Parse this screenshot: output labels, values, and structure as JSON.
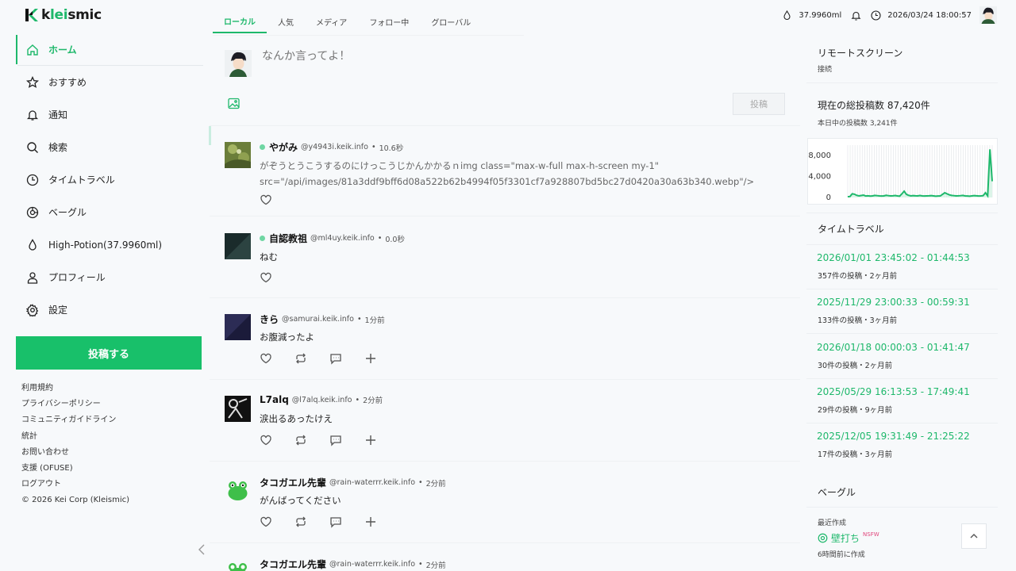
{
  "app": {
    "logo_k": "k",
    "logo_lei": "lei",
    "logo_smic": "smic"
  },
  "sidebar": {
    "items": [
      {
        "label": "ホーム",
        "icon": "home-icon"
      },
      {
        "label": "おすすめ",
        "icon": "star-icon"
      },
      {
        "label": "通知",
        "icon": "bell-icon"
      },
      {
        "label": "検索",
        "icon": "search-icon"
      },
      {
        "label": "タイムトラベル",
        "icon": "clock-icon"
      },
      {
        "label": "ベーグル",
        "icon": "bagel-icon"
      },
      {
        "label": "High-Potion(37.9960ml)",
        "icon": "drop-icon"
      },
      {
        "label": "プロフィール",
        "icon": "user-icon"
      },
      {
        "label": "設定",
        "icon": "gear-icon"
      }
    ],
    "post_button": "投稿する",
    "footer": [
      "利用規約",
      "プライバシーポリシー",
      "コミュニティガイドライン",
      "統計",
      "お問い合わせ",
      "支援 (OFUSE)",
      "ログアウト",
      "© 2026 Kei Corp (Kleismic)"
    ]
  },
  "tabs": [
    "ローカル",
    "人気",
    "メディア",
    "フォロー中",
    "グローバル"
  ],
  "compose": {
    "placeholder": "なんか言ってよ！",
    "submit": "投稿"
  },
  "posts": [
    {
      "name": "やがみ",
      "handle": "@y4943i.keik.info",
      "time": "10.6秒",
      "online": true,
      "body": "がぞうとうこうするのにけっこうじかんかかるｎimg class=\"max-w-full max-h-screen my-1\" src=\"/api/images/81a3ddf9bff6d08a522b62b4994f05f3301cf7a928807bd5bc27d0420a30a63b340.webp\"/>"
    },
    {
      "name": "自認教祖",
      "handle": "@ml4uy.keik.info",
      "time": "0.0秒",
      "online": true,
      "body": "ねむ"
    },
    {
      "name": "きら",
      "handle": "@samurai.keik.info",
      "time": "1分前",
      "online": false,
      "body": "お腹減ったよ"
    },
    {
      "name": "L7alq",
      "handle": "@l7alq.keik.info",
      "time": "2分前",
      "online": false,
      "body": "涙出るあったけえ"
    },
    {
      "name": "タコガエル先輩",
      "handle": "@rain-waterrr.keik.info",
      "time": "2分前",
      "online": false,
      "body": "がんばってください"
    },
    {
      "name": "タコガエル先輩",
      "handle": "@rain-waterrr.keik.info",
      "time": "2分前",
      "online": false,
      "body": ""
    }
  ],
  "topbar": {
    "potion": "37.9960ml",
    "datetime": "2026/03/24 18:00:57"
  },
  "right": {
    "remote_title": "リモートスクリーン",
    "remote_sub": "接続",
    "total_title": "現在の総投稿数 87,420件",
    "total_sub": "本日中の投稿数 3,241件",
    "timetravel_title": "タイムトラベル",
    "timetravel": [
      {
        "range": "2026/01/01 23:45:02 - 01:44:53",
        "meta": "357件の投稿・2ヶ月前"
      },
      {
        "range": "2025/11/29 23:00:33 - 00:59:31",
        "meta": "133件の投稿・3ヶ月前"
      },
      {
        "range": "2026/01/18 00:00:03 - 01:41:47",
        "meta": "30件の投稿・2ヶ月前"
      },
      {
        "range": "2025/05/29 16:13:53 - 17:49:41",
        "meta": "29件の投稿・9ヶ月前"
      },
      {
        "range": "2025/12/05 19:31:49 - 21:25:22",
        "meta": "17件の投稿・3ヶ月前"
      }
    ],
    "bagel_title": "ベーグル",
    "bagel_recent": "最近作成",
    "bagel_item": "壁打ち",
    "bagel_badge": "NSFW",
    "bagel_time": "6時間前に作成"
  },
  "chart_data": {
    "type": "area",
    "yticks": [
      "8,000",
      "4,000",
      "0"
    ],
    "ylim": [
      0,
      10000
    ],
    "values": [
      150,
      180,
      700,
      620,
      400,
      300,
      380,
      450,
      280,
      320,
      260,
      300,
      400,
      350,
      300,
      280,
      300,
      420,
      350,
      300,
      320,
      380,
      300,
      250,
      700,
      1200,
      600,
      400,
      300,
      350,
      320,
      300,
      380,
      300,
      280,
      300,
      320,
      350,
      300,
      250,
      280,
      300,
      600,
      900,
      700,
      500,
      400,
      350,
      300,
      320,
      350,
      400,
      300,
      280,
      250,
      300,
      350,
      320,
      280,
      300,
      350,
      900,
      300,
      9200,
      3100
    ],
    "grid": true,
    "colors": {
      "line": "#1eb86b",
      "fill": "#c8f0dc",
      "grid": "#d9dde1"
    }
  }
}
